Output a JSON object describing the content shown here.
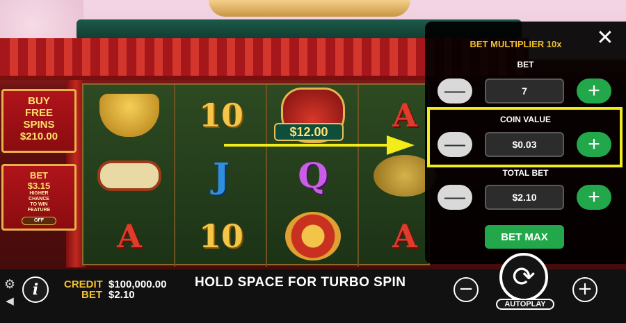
{
  "left_banners": {
    "free_spins": {
      "line1": "BUY",
      "line2": "FREE",
      "line3": "SPINS",
      "price": "$210.00"
    },
    "bet_feature": {
      "line1": "BET",
      "price": "$3.15",
      "desc1": "HIGHER",
      "desc2": "CHANCE",
      "desc3": "TO WIN",
      "desc4": "FEATURE",
      "toggle_label": "OFF"
    }
  },
  "reels": {
    "col1": [
      "gold-pot",
      "scroll",
      "A"
    ],
    "col2": [
      "10",
      "J",
      "10"
    ],
    "col3": [
      "money-bag",
      "Q",
      "coins"
    ],
    "col4": [
      "A",
      "toad",
      "A"
    ],
    "bag_value": "$12.00",
    "ten_label": "10",
    "j_label": "J",
    "q_label": "Q",
    "a_label": "A"
  },
  "panel": {
    "title": "BET MULTIPLIER 10x",
    "close_glyph": "✕",
    "bet": {
      "label": "BET",
      "value": "7"
    },
    "coin_value": {
      "label": "COIN VALUE",
      "value": "$0.03"
    },
    "total_bet": {
      "label": "TOTAL BET",
      "value": "$2.10"
    },
    "bet_max_label": "BET MAX",
    "minus_glyph": "—",
    "plus_glyph": "+"
  },
  "bottom_bar": {
    "credit_label": "CREDIT",
    "credit_value": "$100,000.00",
    "bet_label": "BET",
    "bet_value": "$2.10",
    "message": "HOLD SPACE FOR TURBO SPIN",
    "autoplay_label": "AUTOPLAY",
    "info_glyph": "i",
    "minus_glyph": "−",
    "plus_glyph": "+"
  },
  "colors": {
    "highlight": "#f3ec1a",
    "gold": "#f2c130",
    "plus_green": "#22a84a"
  }
}
